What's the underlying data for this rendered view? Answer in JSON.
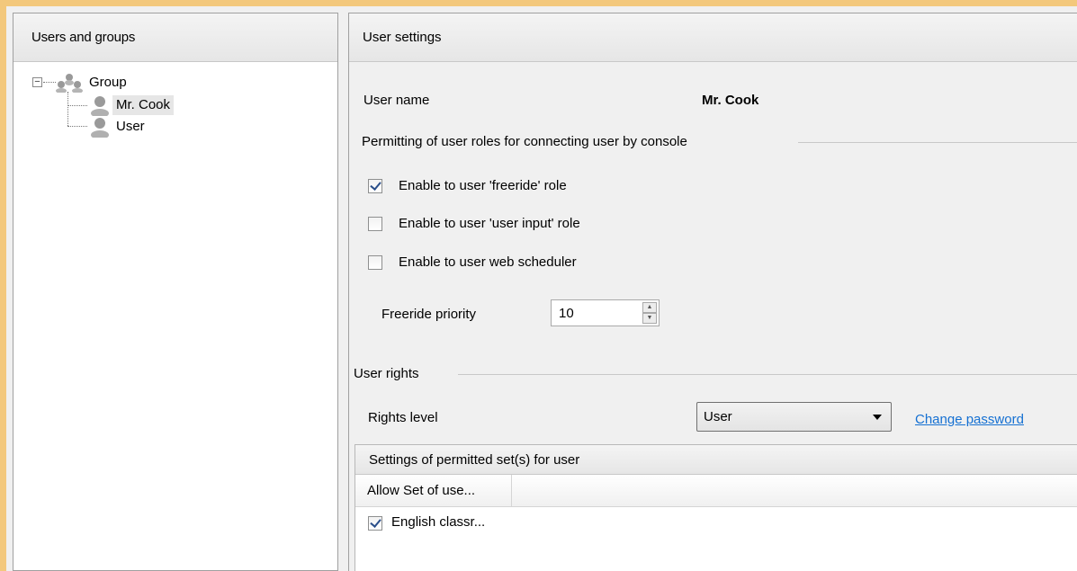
{
  "left_panel": {
    "title": "Users and groups",
    "tree": {
      "group": {
        "label": "Group",
        "expanded": true
      },
      "users": [
        {
          "label": "Mr. Cook",
          "selected": true
        },
        {
          "label": "User",
          "selected": false
        }
      ]
    }
  },
  "right_panel": {
    "title": "User settings",
    "user_name_label": "User name",
    "user_name_value": "Mr. Cook",
    "roles_section": "Permitting of user roles for connecting user by console",
    "checkboxes": [
      {
        "label": "Enable to user 'freeride' role",
        "checked": true
      },
      {
        "label": "Enable to user 'user input' role",
        "checked": false
      },
      {
        "label": "Enable to user web scheduler",
        "checked": false
      }
    ],
    "freeride_priority_label": "Freeride priority",
    "freeride_priority_value": "10",
    "rights_section": "User rights",
    "rights_level_label": "Rights level",
    "rights_level_value": "User",
    "change_password_link": "Change password",
    "sets_panel": {
      "title": "Settings of permitted set(s) for user",
      "column_header": "Allow Set of use...",
      "rows": [
        {
          "label": "English classr...",
          "checked": true
        }
      ]
    }
  },
  "colors": {
    "window_border": "#f3c87c",
    "link": "#1570d2",
    "selection": "#e6e6e6"
  },
  "icons": [
    "group-icon",
    "user-icon",
    "tree-collapse-icon",
    "spin-up-icon",
    "spin-down-icon",
    "dropdown-arrow-icon",
    "checkmark-icon"
  ]
}
